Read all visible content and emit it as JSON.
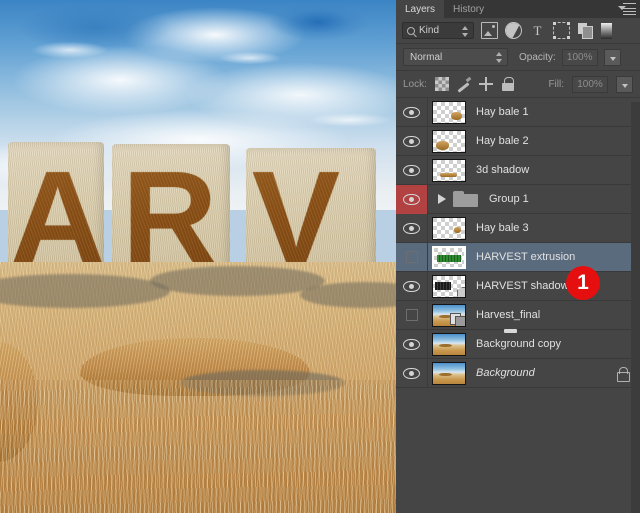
{
  "panel": {
    "tabs": [
      {
        "label": "Layers",
        "active": true
      },
      {
        "label": "History",
        "active": false
      }
    ],
    "menu_icon": "panel-menu-icon",
    "filter": {
      "kind_label": "Kind",
      "search_icon": "search-icon",
      "stepper_icon": "updown-stepper-icon",
      "type_filters": [
        {
          "name": "filter-pixel-layers-icon",
          "glyph": "image"
        },
        {
          "name": "filter-adjustment-layers-icon",
          "glyph": "half-circle"
        },
        {
          "name": "filter-type-layers-icon",
          "glyph": "T"
        },
        {
          "name": "filter-shape-layers-icon",
          "glyph": "shape"
        },
        {
          "name": "filter-smart-object-icon",
          "glyph": "smart-object"
        },
        {
          "name": "filter-toggle-icon",
          "glyph": "gradient-swatch"
        }
      ]
    },
    "blend": {
      "mode": "Normal",
      "opacity_label": "Opacity:",
      "opacity_value": "100%"
    },
    "lock": {
      "label": "Lock:",
      "buttons": [
        {
          "name": "lock-transparent-pixels-icon"
        },
        {
          "name": "lock-image-pixels-icon"
        },
        {
          "name": "lock-position-icon"
        },
        {
          "name": "lock-all-icon"
        }
      ],
      "fill_label": "Fill:",
      "fill_value": "100%"
    },
    "layers": [
      {
        "name": "Hay bale 1",
        "visible": true,
        "thumb": "transparent-bale",
        "selected": false,
        "eye_flagged": false,
        "locked": false,
        "italic": false
      },
      {
        "name": "Hay bale 2",
        "visible": true,
        "thumb": "transparent-bale",
        "selected": false,
        "eye_flagged": false,
        "locked": false,
        "italic": false
      },
      {
        "name": "3d shadow",
        "visible": true,
        "thumb": "transparent-bale",
        "selected": false,
        "eye_flagged": false,
        "locked": false,
        "italic": false
      },
      {
        "name": "Group 1",
        "visible": true,
        "thumb": "group-folder",
        "selected": false,
        "eye_flagged": true,
        "locked": false,
        "italic": false
      },
      {
        "name": "Hay bale 3",
        "visible": true,
        "thumb": "transparent-bale",
        "selected": false,
        "eye_flagged": false,
        "locked": false,
        "italic": false
      },
      {
        "name": "HARVEST extrusion",
        "visible": false,
        "thumb": "green-text",
        "selected": true,
        "eye_flagged": false,
        "locked": false,
        "italic": false
      },
      {
        "name": "HARVEST shadow",
        "visible": true,
        "thumb": "dark-text-cube",
        "selected": false,
        "eye_flagged": false,
        "locked": false,
        "italic": false
      },
      {
        "name": "Harvest_final",
        "visible": false,
        "thumb": "photo-smart",
        "selected": false,
        "eye_flagged": false,
        "locked": false,
        "italic": false
      },
      {
        "name": "Background copy",
        "visible": true,
        "thumb": "photo",
        "selected": false,
        "eye_flagged": false,
        "locked": false,
        "italic": false
      },
      {
        "name": "Background",
        "visible": true,
        "thumb": "photo",
        "selected": false,
        "eye_flagged": false,
        "locked": true,
        "italic": true
      }
    ]
  },
  "annotation": {
    "badge_number": "1",
    "badge_color": "#e60f0f"
  },
  "canvas": {
    "letters": [
      "A",
      "R",
      "V"
    ],
    "description": "hay-bale-harvest-letters-photo"
  },
  "colors": {
    "panel_bg": "#454545",
    "tab_bg": "#363636",
    "selected_row": "#5b6b7e",
    "flagged_eye": "#b24242",
    "text": "#e0e0e0"
  }
}
